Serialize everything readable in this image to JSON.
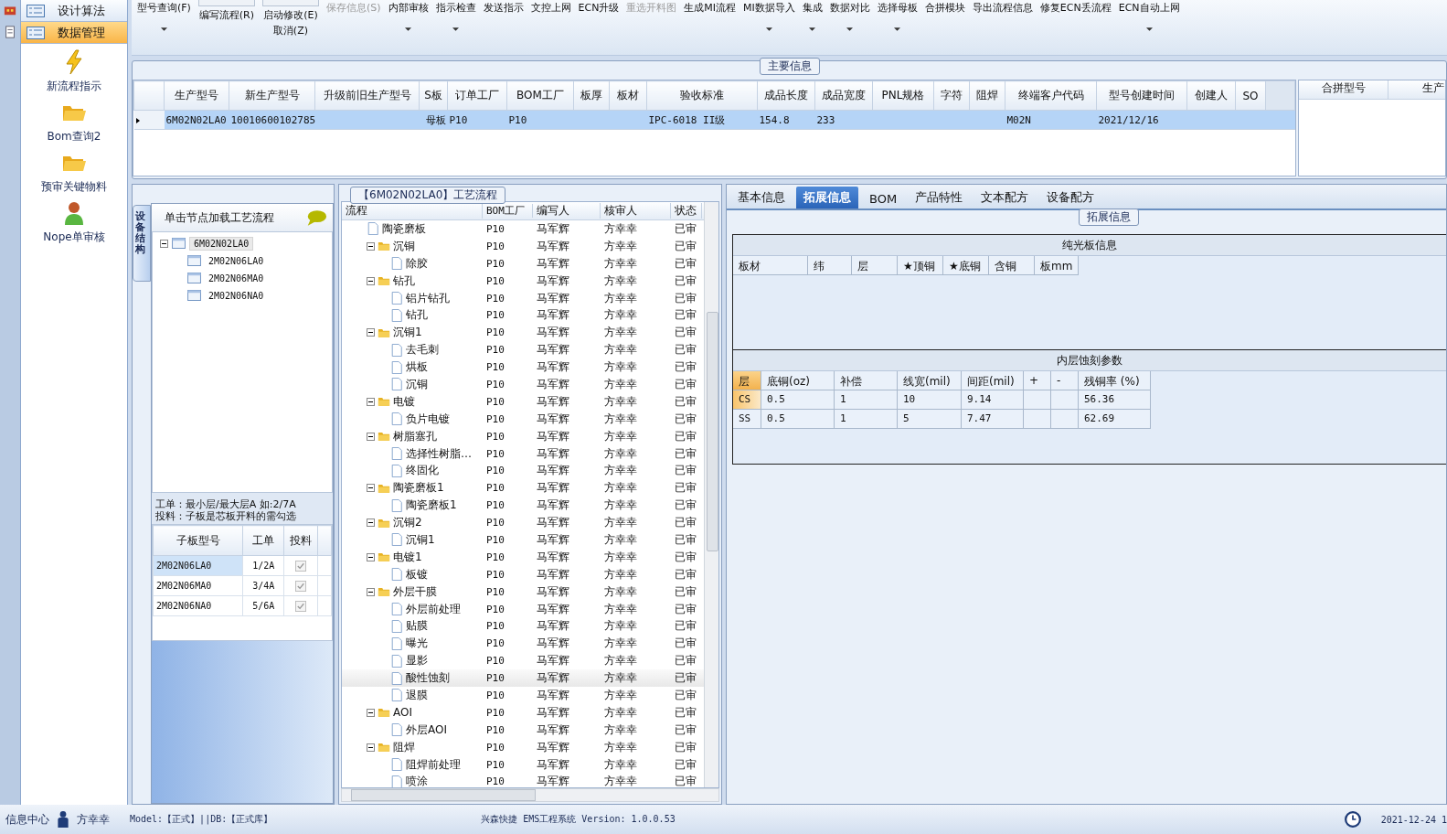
{
  "nav": {
    "items": [
      {
        "label": "设计算法",
        "selected": false
      },
      {
        "label": "数据管理",
        "selected": true
      }
    ],
    "actions": [
      {
        "label": "新流程指示",
        "kind": "bolt"
      },
      {
        "label": "Bom查询2",
        "kind": "folder"
      },
      {
        "label": "预审关键物料",
        "kind": "folder"
      },
      {
        "label": "Nope单审核",
        "kind": "person"
      }
    ]
  },
  "toolbar": [
    {
      "label": "型号查询(F)",
      "kind": "dropdown",
      "disabled": false
    },
    {
      "label": "编写流程(R)",
      "kind": "stacked",
      "disabled": false
    },
    {
      "label": "启动修改(E)",
      "kind": "stacked",
      "sub": "取消(Z)",
      "disabled": false
    },
    {
      "label": "保存信息(S)",
      "kind": "plain",
      "disabled": true
    },
    {
      "label": "内部审核",
      "kind": "dropdown",
      "disabled": false
    },
    {
      "label": "指示检查",
      "kind": "dropdown",
      "disabled": false
    },
    {
      "label": "发送指示",
      "kind": "plain",
      "disabled": false
    },
    {
      "label": "文控上网",
      "kind": "plain",
      "disabled": false
    },
    {
      "label": "ECN升级",
      "kind": "plain",
      "disabled": false
    },
    {
      "label": "重选开料图",
      "kind": "plain",
      "disabled": true
    },
    {
      "label": "生成MI流程",
      "kind": "plain",
      "disabled": false
    },
    {
      "label": "MI数据导入",
      "kind": "dropdown",
      "disabled": false
    },
    {
      "label": "集成",
      "kind": "dropdown",
      "disabled": false
    },
    {
      "label": "数据对比",
      "kind": "dropdown",
      "disabled": false
    },
    {
      "label": "选择母板",
      "kind": "dropdown",
      "disabled": false
    },
    {
      "label": "合拼模块",
      "kind": "plain",
      "disabled": false
    },
    {
      "label": "导出流程信息",
      "kind": "plain",
      "disabled": false
    },
    {
      "label": "修复ECN丢流程",
      "kind": "plain",
      "disabled": false
    },
    {
      "label": "ECN自动上网",
      "kind": "dropdown",
      "disabled": false
    }
  ],
  "main_info": {
    "title": "主要信息",
    "columns": [
      "生产型号",
      "新生产型号",
      "升级前旧生产型号",
      "S板",
      "订单工厂",
      "BOM工厂",
      "板厚",
      "板材",
      "验收标准",
      "成品长度",
      "成品宽度",
      "PNL规格",
      "字符",
      "阻焊",
      "终端客户代码",
      "型号创建时间",
      "创建人",
      "SO"
    ],
    "rows": [
      {
        "selected": true,
        "cells": [
          "6M02N02LA0",
          "10010600102785",
          "",
          "母板",
          "P10",
          "P10",
          "",
          "",
          "IPC-6018 II级",
          "154.8",
          "233",
          "",
          "",
          "",
          "M02N",
          "2021/12/16",
          "",
          ""
        ]
      }
    ],
    "side_columns": [
      "合拼型号",
      "生产"
    ]
  },
  "structure": {
    "tab": "设备结构",
    "header": "单击节点加载工艺流程",
    "tree": [
      {
        "label": "6M02N02LA0",
        "expanded": true,
        "selected": true,
        "children": [
          {
            "label": "2M02N06LA0",
            "selected": false
          },
          {
            "label": "2M02N06MA0",
            "selected": false
          },
          {
            "label": "2M02N06NA0",
            "selected": false
          }
        ]
      }
    ],
    "note": [
      "工单：最小层/最大层A 如:2/7A",
      "投料：子板是芯板开料的需勾选"
    ],
    "columns": [
      "子板型号",
      "工单",
      "投料"
    ],
    "rows": [
      {
        "board": "2M02N06LA0",
        "order": "1/2A",
        "checked": true,
        "selected": true
      },
      {
        "board": "2M02N06MA0",
        "order": "3/4A",
        "checked": true,
        "selected": false
      },
      {
        "board": "2M02N06NA0",
        "order": "5/6A",
        "checked": true,
        "selected": false
      }
    ]
  },
  "process": {
    "title": "【6M02N02LA0】工艺流程",
    "columns": [
      "流程",
      "BOM工厂",
      "编写人",
      "核审人",
      "状态"
    ],
    "steps": [
      {
        "name": "陶瓷磨板",
        "bom": "P10",
        "writer": "马军辉",
        "reviewer": "方幸幸",
        "status": "已审",
        "selected": false
      },
      {
        "name": "沉铜",
        "bom": "P10",
        "writer": "马军辉",
        "reviewer": "方幸幸",
        "status": "已审",
        "selected": false,
        "expanded": true,
        "children": [
          {
            "name": "除胶",
            "bom": "P10",
            "writer": "马军辉",
            "reviewer": "方幸幸",
            "status": "已审",
            "selected": false
          }
        ]
      },
      {
        "name": "钻孔",
        "bom": "P10",
        "writer": "马军辉",
        "reviewer": "方幸幸",
        "status": "已审",
        "selected": false,
        "expanded": true,
        "children": [
          {
            "name": "铝片钻孔",
            "bom": "P10",
            "writer": "马军辉",
            "reviewer": "方幸幸",
            "status": "已审",
            "selected": false
          },
          {
            "name": "钻孔",
            "bom": "P10",
            "writer": "马军辉",
            "reviewer": "方幸幸",
            "status": "已审",
            "selected": false
          }
        ]
      },
      {
        "name": "沉铜1",
        "bom": "P10",
        "writer": "马军辉",
        "reviewer": "方幸幸",
        "status": "已审",
        "selected": false,
        "expanded": true,
        "children": [
          {
            "name": "去毛刺",
            "bom": "P10",
            "writer": "马军辉",
            "reviewer": "方幸幸",
            "status": "已审",
            "selected": false
          },
          {
            "name": "烘板",
            "bom": "P10",
            "writer": "马军辉",
            "reviewer": "方幸幸",
            "status": "已审",
            "selected": false
          },
          {
            "name": "沉铜",
            "bom": "P10",
            "writer": "马军辉",
            "reviewer": "方幸幸",
            "status": "已审",
            "selected": false
          }
        ]
      },
      {
        "name": "电镀",
        "bom": "P10",
        "writer": "马军辉",
        "reviewer": "方幸幸",
        "status": "已审",
        "selected": false,
        "expanded": true,
        "children": [
          {
            "name": "负片电镀",
            "bom": "P10",
            "writer": "马军辉",
            "reviewer": "方幸幸",
            "status": "已审",
            "selected": false
          }
        ]
      },
      {
        "name": "树脂塞孔",
        "bom": "P10",
        "writer": "马军辉",
        "reviewer": "方幸幸",
        "status": "已审",
        "selected": false,
        "expanded": true,
        "children": [
          {
            "name": "选择性树脂…",
            "bom": "P10",
            "writer": "马军辉",
            "reviewer": "方幸幸",
            "status": "已审",
            "selected": false
          },
          {
            "name": "终固化",
            "bom": "P10",
            "writer": "马军辉",
            "reviewer": "方幸幸",
            "status": "已审",
            "selected": false
          }
        ]
      },
      {
        "name": "陶瓷磨板1",
        "bom": "P10",
        "writer": "马军辉",
        "reviewer": "方幸幸",
        "status": "已审",
        "selected": false,
        "expanded": true,
        "children": [
          {
            "name": "陶瓷磨板1",
            "bom": "P10",
            "writer": "马军辉",
            "reviewer": "方幸幸",
            "status": "已审",
            "selected": false
          }
        ]
      },
      {
        "name": "沉铜2",
        "bom": "P10",
        "writer": "马军辉",
        "reviewer": "方幸幸",
        "status": "已审",
        "selected": false,
        "expanded": true,
        "children": [
          {
            "name": "沉铜1",
            "bom": "P10",
            "writer": "马军辉",
            "reviewer": "方幸幸",
            "status": "已审",
            "selected": false
          }
        ]
      },
      {
        "name": "电镀1",
        "bom": "P10",
        "writer": "马军辉",
        "reviewer": "方幸幸",
        "status": "已审",
        "selected": false,
        "expanded": true,
        "children": [
          {
            "name": "板镀",
            "bom": "P10",
            "writer": "马军辉",
            "reviewer": "方幸幸",
            "status": "已审",
            "selected": false
          }
        ]
      },
      {
        "name": "外层干膜",
        "bom": "P10",
        "writer": "马军辉",
        "reviewer": "方幸幸",
        "status": "已审",
        "selected": false,
        "expanded": true,
        "children": [
          {
            "name": "外层前处理",
            "bom": "P10",
            "writer": "马军辉",
            "reviewer": "方幸幸",
            "status": "已审",
            "selected": false
          },
          {
            "name": "贴膜",
            "bom": "P10",
            "writer": "马军辉",
            "reviewer": "方幸幸",
            "status": "已审",
            "selected": false
          },
          {
            "name": "曝光",
            "bom": "P10",
            "writer": "马军辉",
            "reviewer": "方幸幸",
            "status": "已审",
            "selected": false
          },
          {
            "name": "显影",
            "bom": "P10",
            "writer": "马军辉",
            "reviewer": "方幸幸",
            "status": "已审",
            "selected": false
          },
          {
            "name": "酸性蚀刻",
            "bom": "P10",
            "writer": "马军辉",
            "reviewer": "方幸幸",
            "status": "已审",
            "selected": true
          },
          {
            "name": "退膜",
            "bom": "P10",
            "writer": "马军辉",
            "reviewer": "方幸幸",
            "status": "已审",
            "selected": false
          }
        ]
      },
      {
        "name": "AOI",
        "bom": "P10",
        "writer": "马军辉",
        "reviewer": "方幸幸",
        "status": "已审",
        "selected": false,
        "expanded": true,
        "children": [
          {
            "name": "外层AOI",
            "bom": "P10",
            "writer": "马军辉",
            "reviewer": "方幸幸",
            "status": "已审",
            "selected": false
          }
        ]
      },
      {
        "name": "阻焊",
        "bom": "P10",
        "writer": "马军辉",
        "reviewer": "方幸幸",
        "status": "已审",
        "selected": false,
        "expanded": true,
        "children": [
          {
            "name": "阻焊前处理",
            "bom": "P10",
            "writer": "马军辉",
            "reviewer": "方幸幸",
            "status": "已审",
            "selected": false
          },
          {
            "name": "喷涂",
            "bom": "P10",
            "writer": "马军辉",
            "reviewer": "方幸幸",
            "status": "已审",
            "selected": false
          }
        ]
      }
    ]
  },
  "details": {
    "tabs": [
      {
        "label": "基本信息",
        "selected": false
      },
      {
        "label": "拓展信息",
        "selected": true
      },
      {
        "label": "BOM",
        "selected": false
      },
      {
        "label": "产品特性",
        "selected": false
      },
      {
        "label": "文本配方",
        "selected": false
      },
      {
        "label": "设备配方",
        "selected": false
      }
    ],
    "group_title": "拓展信息",
    "bare_board": {
      "title": "纯光板信息",
      "columns": [
        "板材",
        "纬",
        "层",
        "★顶铜",
        "★底铜",
        "含铜",
        "板mm"
      ]
    },
    "etch": {
      "title": "内层蚀刻参数",
      "columns": [
        "层",
        "底铜(oz)",
        "补偿",
        "线宽(mil)",
        "间距(mil)",
        "+",
        "-",
        "残铜率 (%)"
      ],
      "rows": [
        {
          "selected": true,
          "cells": [
            "CS",
            "0.5",
            "1",
            "10",
            "9.14",
            "",
            "",
            "56.36"
          ]
        },
        {
          "selected": false,
          "cells": [
            "SS",
            "0.5",
            "1",
            "5",
            "7.47",
            "",
            "",
            "62.69"
          ]
        }
      ]
    }
  },
  "status_bar": {
    "info": "信息中心",
    "user": "方幸幸",
    "env": "Model:【正式】||DB:【正式库】",
    "app": "兴森快捷 EMS工程系统 Version: 1.0.0.53",
    "time": "2021-12-24 1"
  }
}
